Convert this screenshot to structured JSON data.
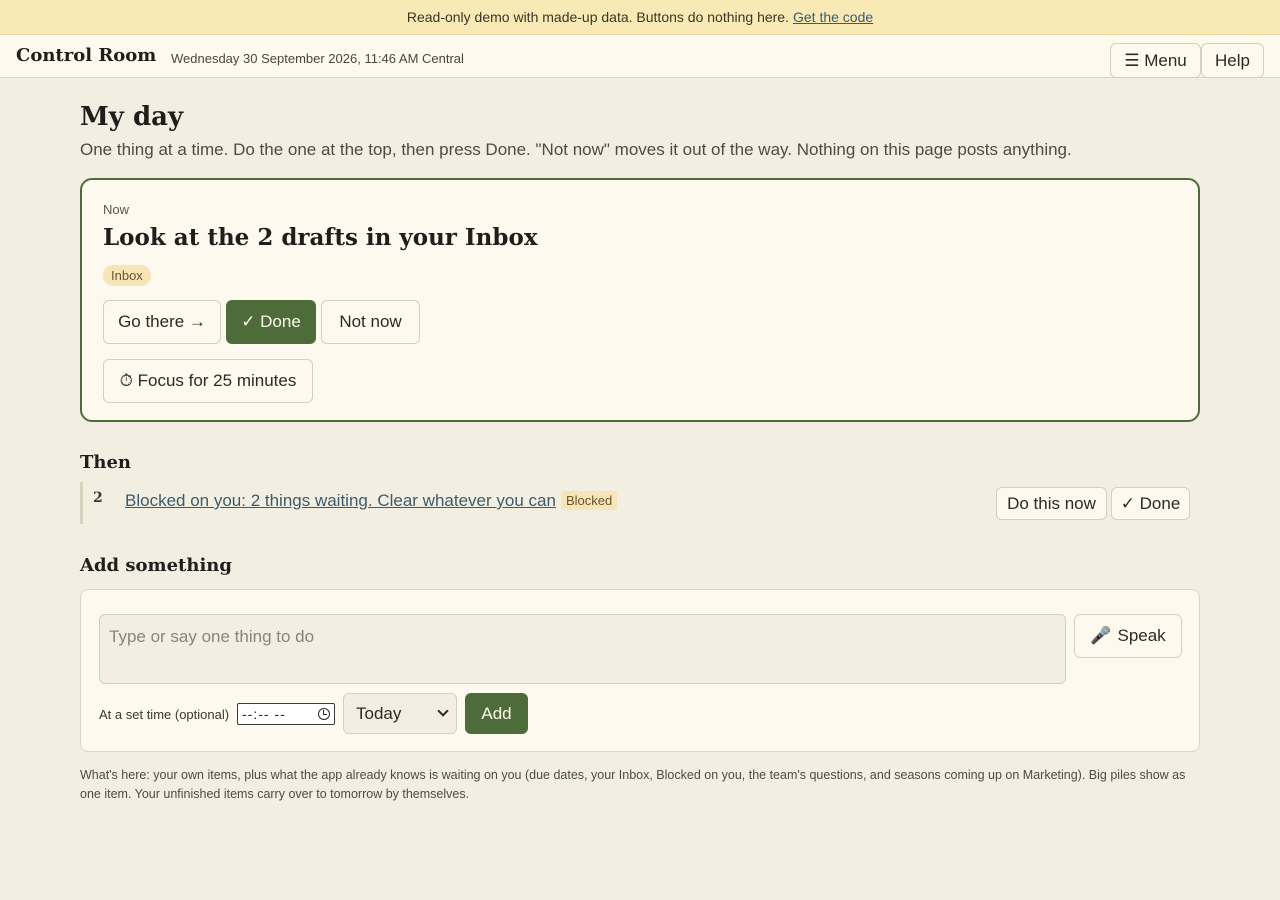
{
  "banner": {
    "text": "Read-only demo with made-up data. Buttons do nothing here.",
    "link": "Get the code"
  },
  "topbar": {
    "brand": "Control Room",
    "datetime": "Wednesday 30 September 2026, 11:46 AM Central",
    "menu_label": "☰ Menu",
    "help_label": "Help"
  },
  "page": {
    "title": "My day",
    "intro": "One thing at a time. Do the one at the top, then press Done. \"Not now\" moves it out of the way. Nothing on this page posts anything."
  },
  "now": {
    "label": "Now",
    "title": "Look at the 2 drafts in your Inbox",
    "tag": "Inbox",
    "go_label": "Go there →",
    "done_label": "✓ Done",
    "notnow_label": "Not now",
    "focus_label": "⏱ Focus for 25 minutes"
  },
  "then": {
    "heading": "Then",
    "items": [
      {
        "number": "2",
        "text": "Blocked on you: 2 things waiting. Clear whatever you can",
        "tag": "Blocked",
        "do_label": "Do this now",
        "done_label": "✓ Done"
      }
    ]
  },
  "add": {
    "heading": "Add something",
    "placeholder": "Type or say one thing to do",
    "speak_label": "Speak",
    "time_label": "At a set time (optional)",
    "time_value": "--:-- --",
    "day_selected": "Today",
    "add_label": "Add"
  },
  "footnote": "What's here: your own items, plus what the app already knows is waiting on you (due dates, your Inbox, Blocked on you, the team's questions, and seasons coming up on Marketing). Big piles show as one item. Your unfinished items carry over to tomorrow by themselves.",
  "colors": {
    "accent": "#4e6b3a",
    "banner": "#f8e9b5",
    "tag": "#f6e5b8",
    "link": "#3c5c6e"
  }
}
